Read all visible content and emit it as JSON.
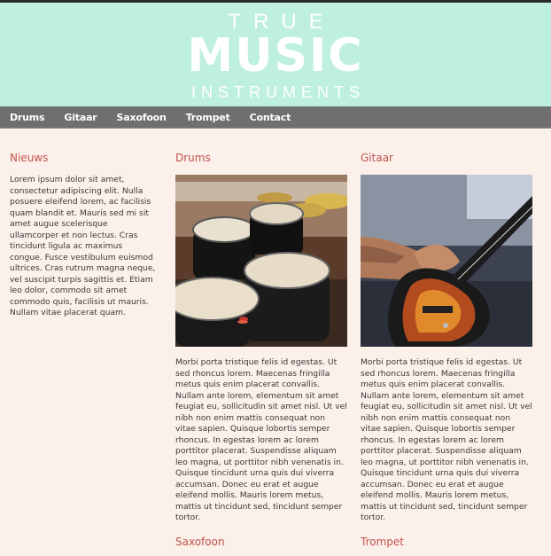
{
  "header": {
    "logo_true": "TRUE",
    "logo_music": "MUSIC",
    "logo_instruments": "INSTRUMENTS"
  },
  "nav": {
    "items": [
      "Drums",
      "Gitaar",
      "Saxofoon",
      "Trompet",
      "Contact"
    ]
  },
  "news": {
    "title": "Nieuws",
    "text": "Lorem ipsum dolor sit amet, consectetur adipiscing elit. Nulla posuere eleifend lorem, ac facilisis quam blandit et. Mauris sed mi sit amet augue scelerisque ullamcorper et non lectus. Cras tincidunt ligula ac maximus congue. Fusce vestibulum euismod ultrices. Cras rutrum magna neque, vel suscipit turpis sagittis et. Etiam leo dolor, commodo sit amet commodo quis, facilisis ut mauris. Nullam vitae placerat quam."
  },
  "drums": {
    "title": "Drums",
    "image_alt": "drum kit photo",
    "text": "Morbi porta tristique felis id egestas. Ut sed rhoncus lorem. Maecenas fringilla metus quis enim placerat convallis. Nullam ante lorem, elementum sit amet feugiat eu, sollicitudin sit amet nisl. Ut vel nibh non enim mattis consequat non vitae sapien. Quisque lobortis semper rhoncus. In egestas lorem ac lorem porttitor placerat. Suspendisse aliquam leo magna, ut porttitor nibh venenatis in. Quisque tincidunt urna quis dui viverra accumsan. Donec eu erat et augue eleifend mollis. Mauris lorem metus, mattis ut tincidunt sed, tincidunt semper tortor."
  },
  "gitaar": {
    "title": "Gitaar",
    "image_alt": "guitar photo",
    "text": "Morbi porta tristique felis id egestas. Ut sed rhoncus lorem. Maecenas fringilla metus quis enim placerat convallis. Nullam ante lorem, elementum sit amet feugiat eu, sollicitudin sit amet nisl. Ut vel nibh non enim mattis consequat non vitae sapien. Quisque lobortis semper rhoncus. In egestas lorem ac lorem porttitor placerat. Suspendisse aliquam leo magna, ut porttitor nibh venenatis in. Quisque tincidunt urna quis dui viverra accumsan. Donec eu erat et augue eleifend mollis. Mauris lorem metus, mattis ut tincidunt sed, tincidunt semper tortor."
  },
  "bottom": {
    "saxofoon_title": "Saxofoon",
    "trompet_title": "Trompet"
  },
  "colors": {
    "header_bg": "#bff0df",
    "nav_bg": "#6f6f6f",
    "page_bg": "#fbf0ea",
    "accent": "#c2524d"
  }
}
